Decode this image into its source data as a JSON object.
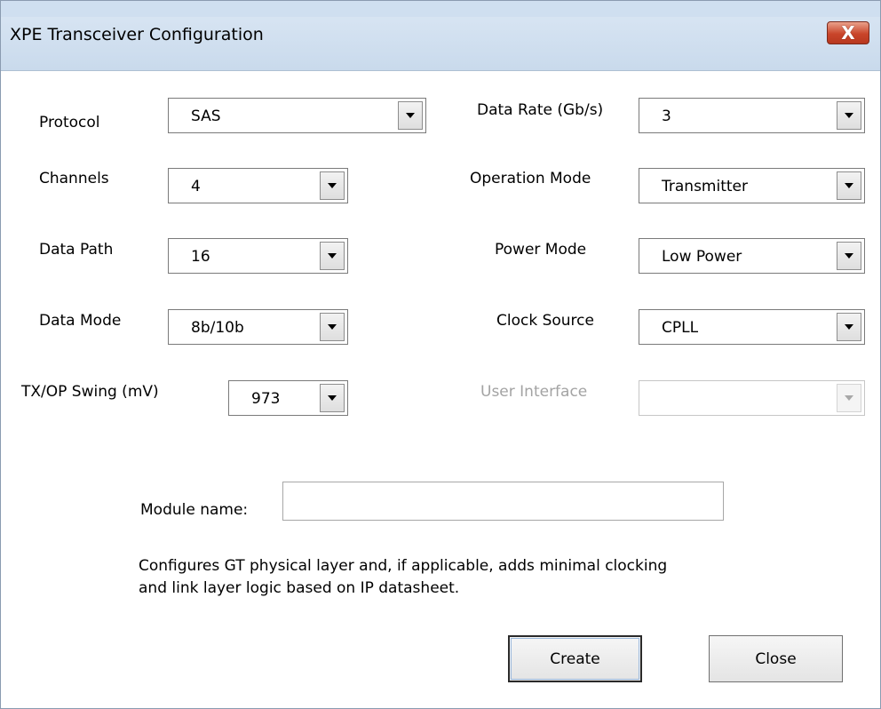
{
  "window": {
    "title": "XPE Transceiver Configuration",
    "close_glyph": "X"
  },
  "fields": {
    "protocol": {
      "label": "Protocol",
      "value": "SAS"
    },
    "channels": {
      "label": "Channels",
      "value": "4"
    },
    "data_path": {
      "label": "Data Path",
      "value": "16"
    },
    "data_mode": {
      "label": "Data Mode",
      "value": "8b/10b"
    },
    "tx_swing": {
      "label": "TX/OP Swing (mV)",
      "value": "973"
    },
    "data_rate": {
      "label": "Data Rate (Gb/s)",
      "value": "3"
    },
    "operation_mode": {
      "label": "Operation Mode",
      "value": "Transmitter"
    },
    "power_mode": {
      "label": "Power Mode",
      "value": "Low Power"
    },
    "clock_source": {
      "label": "Clock Source",
      "value": "CPLL"
    },
    "user_interface": {
      "label": "User Interface",
      "value": "",
      "disabled": true
    }
  },
  "module": {
    "label": "Module name:",
    "value": ""
  },
  "description": {
    "line1": "Configures GT physical layer and, if applicable, adds minimal clocking",
    "line2": "and link layer logic based on IP datasheet."
  },
  "buttons": {
    "create": "Create",
    "close": "Close"
  },
  "colors": {
    "title_gradient_top": "#dbe7f4",
    "title_gradient_bottom": "#c9daec",
    "close_button": "#c9452a",
    "disabled_text": "#a3a3a3"
  },
  "icons": {
    "dropdown": "chevron-down-icon",
    "close": "close-icon"
  }
}
